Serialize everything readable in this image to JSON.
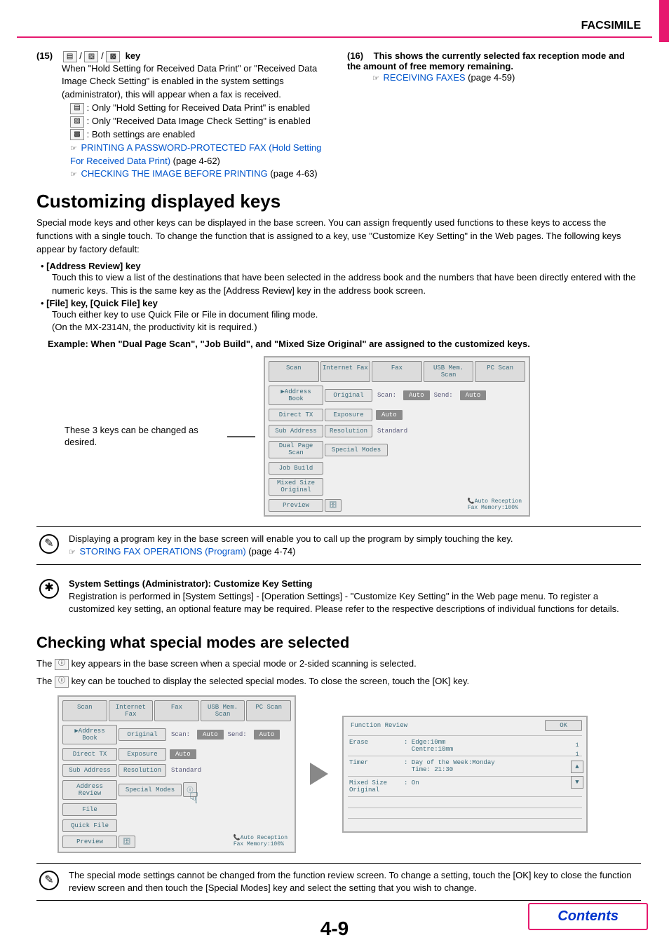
{
  "header": {
    "section": "FACSIMILE"
  },
  "item15": {
    "num": "(15)",
    "key_label": "key",
    "body1": "When \"Hold Setting for Received Data Print\" or \"Received Data Image Check Setting\" is enabled in the system settings (administrator), this will appear when a fax is received.",
    "line_a": ": Only \"Hold Setting for Received Data Print\" is enabled",
    "line_b": ": Only \"Received Data Image Check Setting\" is enabled",
    "line_c": ": Both settings are enabled",
    "link1": "PRINTING A PASSWORD-PROTECTED FAX (Hold Setting For Received Data Print)",
    "link1_page": " (page 4-62)",
    "link2": "CHECKING THE IMAGE BEFORE PRINTING",
    "link2_page": " (page 4-63)"
  },
  "item16": {
    "num": "(16)",
    "head": "This shows the currently selected fax reception mode and the amount of free memory remaining.",
    "link": "RECEIVING FAXES",
    "link_page": " (page 4-59)"
  },
  "customizing": {
    "title": "Customizing displayed keys",
    "intro": "Special mode keys and other keys can be displayed in the base screen. You can assign frequently used functions to these keys to access the functions with a single touch. To change the function that is assigned to a key, use \"Customize Key Setting\" in the Web pages. The following keys appear by factory default:",
    "b1_head": "[Address Review] key",
    "b1_body": "Touch this to view a list of the destinations that have been selected in the address book and the numbers that have been directly entered with the numeric keys. This is the same key as the [Address Review] key in the address book screen.",
    "b2_head": "[File] key, [Quick File] key",
    "b2_body1": "Touch either key to use Quick File or File in document filing mode.",
    "b2_body2": "(On the MX-2314N, the productivity kit is required.)",
    "example": "Example: When \"Dual Page Scan\", \"Job Build\", and \"Mixed Size Original\" are assigned to the customized keys.",
    "caption": "These 3 keys can be changed as desired."
  },
  "ui1": {
    "tabs": [
      "Scan",
      "Internet Fax",
      "Fax",
      "USB Mem. Scan",
      "PC Scan"
    ],
    "side": [
      "Address Book",
      "Direct TX",
      "Sub Address",
      "Dual Page\nScan",
      "Job Build",
      "Mixed Size\nOriginal",
      "Preview"
    ],
    "rows": {
      "original": "Original",
      "scan_label": "Scan:",
      "scan_val": "Auto",
      "send_label": "Send:",
      "send_val": "Auto",
      "exposure": "Exposure",
      "exposure_val": "Auto",
      "resolution": "Resolution",
      "resolution_val": "Standard",
      "special": "Special Modes"
    },
    "status": {
      "l1": "Auto Reception",
      "l2": "Fax Memory:100%"
    }
  },
  "note1": {
    "line1": "Displaying a program key in the base screen will enable you to call up the program by simply touching the key.",
    "link": "STORING FAX OPERATIONS (Program)",
    "link_page": " (page 4-74)"
  },
  "note2": {
    "head": "System Settings (Administrator): Customize Key Setting",
    "body": "Registration is performed in [System Settings] - [Operation Settings] - \"Customize Key Setting\" in the Web page menu. To register a customized key setting, an optional feature may be required.  Please refer to the respective descriptions of individual functions for details."
  },
  "checking": {
    "title": "Checking what special modes are selected",
    "line1a": "The ",
    "line1b": " key appears in the base screen when a special mode or 2-sided scanning is selected.",
    "line2a": "The ",
    "line2b": " key can be touched to display the selected special modes. To close the screen, touch the [OK] key."
  },
  "ui2": {
    "tabs": [
      "Scan",
      "Internet Fax",
      "Fax",
      "USB Mem. Scan",
      "PC Scan"
    ],
    "side": [
      "Address Book",
      "Direct TX",
      "Sub Address",
      "Address Review",
      "File",
      "Quick File",
      "Preview"
    ],
    "rows": {
      "original": "Original",
      "scan_label": "Scan:",
      "scan_val": "Auto",
      "send_label": "Send:",
      "send_val": "Auto",
      "exposure": "Exposure",
      "exposure_val": "Auto",
      "resolution": "Resolution",
      "resolution_val": "Standard",
      "special": "Special Modes"
    },
    "status": {
      "l1": "Auto Reception",
      "l2": "Fax Memory:100%"
    }
  },
  "review": {
    "title": "Function Review",
    "ok": "OK",
    "rows": [
      {
        "label": "Erase",
        "val": ": Edge:10mm\n  Centre:10mm"
      },
      {
        "label": "Timer",
        "val": ": Day of the Week:Monday\n  Time: 21:30"
      },
      {
        "label": "Mixed Size\nOriginal",
        "val": ": On"
      }
    ],
    "page_top": "1",
    "page_bottom": "1"
  },
  "note3": "The special mode settings cannot be changed from the function review screen. To change a setting, touch the [OK] key to close the function review screen and then touch the [Special Modes] key and select the setting that you wish to change.",
  "footer": {
    "page": "4-9",
    "contents": "Contents"
  }
}
